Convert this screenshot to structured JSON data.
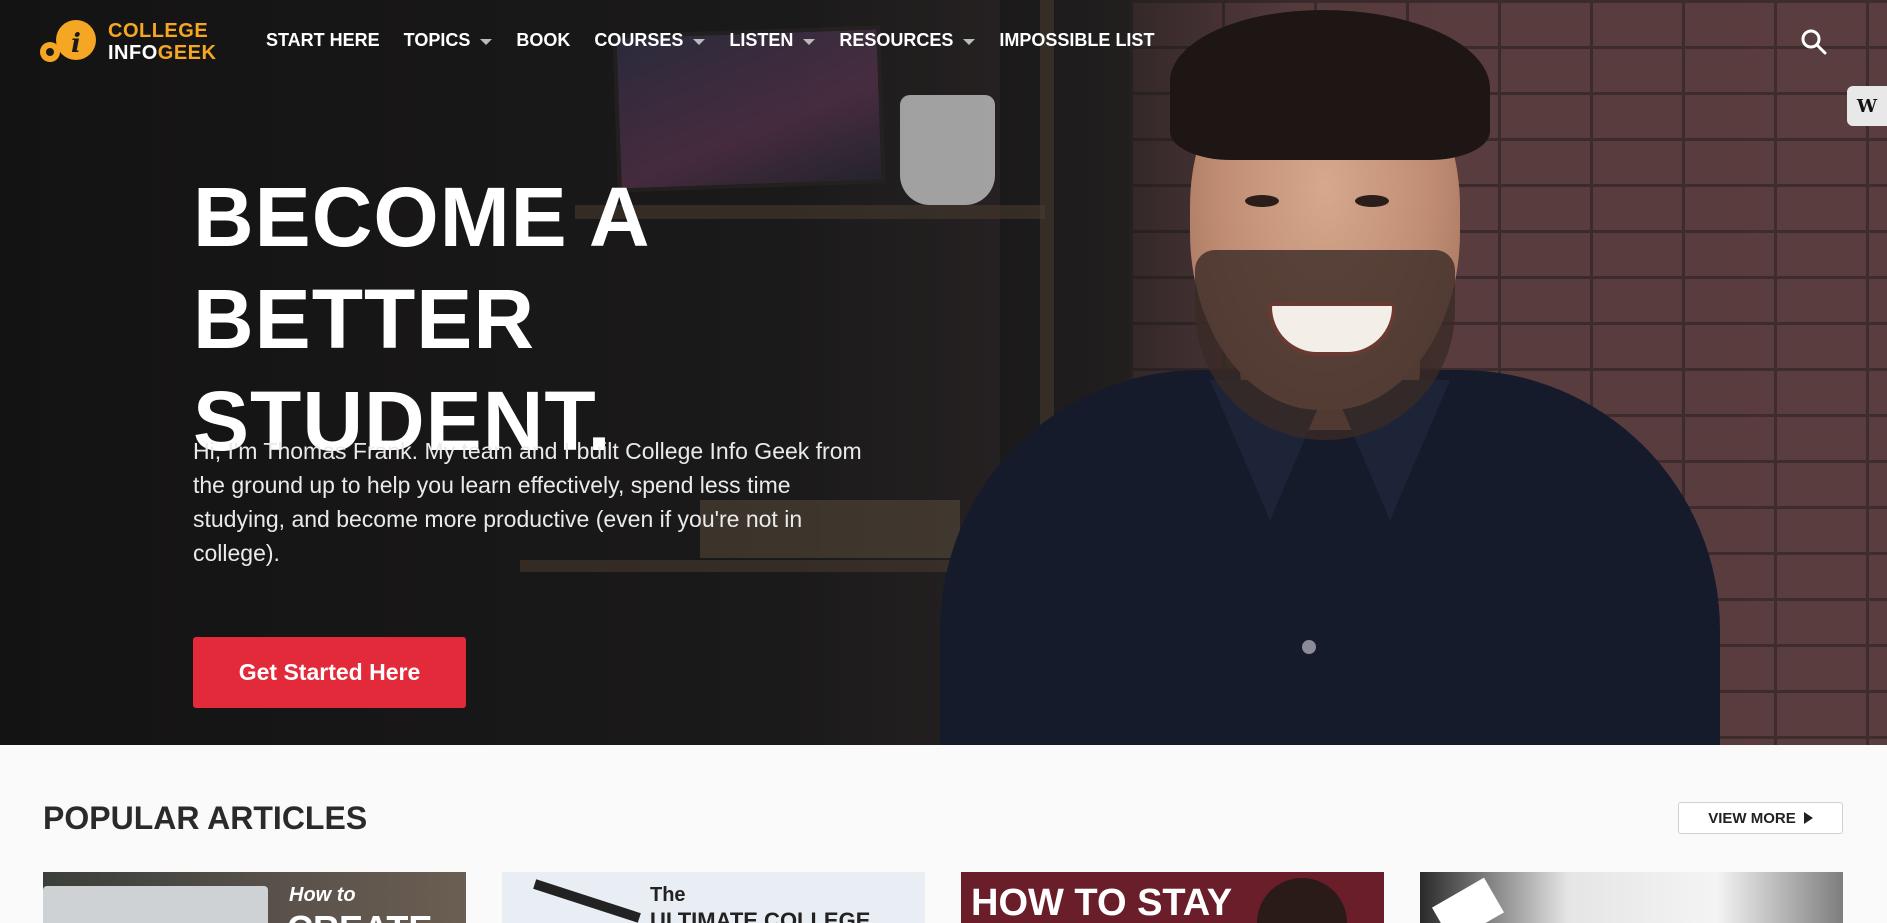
{
  "logo": {
    "line1": "COLLEGE",
    "line2a": "INFO",
    "line2b": "GEEK"
  },
  "nav": {
    "items": [
      {
        "label": "START HERE",
        "has_dropdown": false
      },
      {
        "label": "TOPICS",
        "has_dropdown": true
      },
      {
        "label": "BOOK",
        "has_dropdown": false
      },
      {
        "label": "COURSES",
        "has_dropdown": true
      },
      {
        "label": "LISTEN",
        "has_dropdown": true
      },
      {
        "label": "RESOURCES",
        "has_dropdown": true
      },
      {
        "label": "IMPOSSIBLE LIST",
        "has_dropdown": false
      }
    ],
    "search_icon": "search-icon"
  },
  "side_tab": {
    "label": "W"
  },
  "hero": {
    "headline_line1": "BECOME A BETTER",
    "headline_line2": "STUDENT.",
    "intro": "Hi, I'm Thomas Frank. My team and I built College Info Geek from the ground up to help you learn effectively, spend less time studying, and become more productive (even if you're not in college).",
    "cta_label": "Get Started Here"
  },
  "popular": {
    "title": "POPULAR ARTICLES",
    "view_more_label": "VIEW MORE",
    "cards": [
      {
        "line1": "How to",
        "line2": "CREATE"
      },
      {
        "line1": "The",
        "line2": "ULTIMATE COLLEGE"
      },
      {
        "line1": "HOW TO STAY",
        "line2": ""
      },
      {
        "line1": "",
        "line2": ""
      }
    ]
  },
  "colors": {
    "brand_orange": "#f5a623",
    "cta_red": "#e22a3b",
    "hero_dark": "#1b1a1a"
  }
}
